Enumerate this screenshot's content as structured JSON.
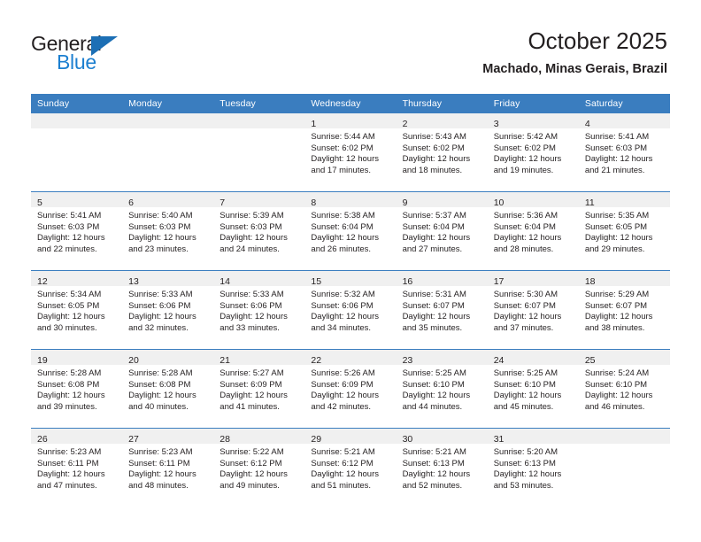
{
  "brand": {
    "name_top": "General",
    "name_bottom": "Blue",
    "accent_color": "#1c7fd0",
    "triangle_color": "#1c6fb5"
  },
  "header": {
    "title": "October 2025",
    "subtitle": "Machado, Minas Gerais, Brazil"
  },
  "calendar": {
    "header_bg": "#3a7dbf",
    "daynum_bg": "#f0f0f0",
    "weekday_headers": [
      "Sunday",
      "Monday",
      "Tuesday",
      "Wednesday",
      "Thursday",
      "Friday",
      "Saturday"
    ],
    "weeks": [
      [
        {
          "day": "",
          "lines": []
        },
        {
          "day": "",
          "lines": []
        },
        {
          "day": "",
          "lines": []
        },
        {
          "day": "1",
          "lines": [
            "Sunrise: 5:44 AM",
            "Sunset: 6:02 PM",
            "Daylight: 12 hours",
            "and 17 minutes."
          ]
        },
        {
          "day": "2",
          "lines": [
            "Sunrise: 5:43 AM",
            "Sunset: 6:02 PM",
            "Daylight: 12 hours",
            "and 18 minutes."
          ]
        },
        {
          "day": "3",
          "lines": [
            "Sunrise: 5:42 AM",
            "Sunset: 6:02 PM",
            "Daylight: 12 hours",
            "and 19 minutes."
          ]
        },
        {
          "day": "4",
          "lines": [
            "Sunrise: 5:41 AM",
            "Sunset: 6:03 PM",
            "Daylight: 12 hours",
            "and 21 minutes."
          ]
        }
      ],
      [
        {
          "day": "5",
          "lines": [
            "Sunrise: 5:41 AM",
            "Sunset: 6:03 PM",
            "Daylight: 12 hours",
            "and 22 minutes."
          ]
        },
        {
          "day": "6",
          "lines": [
            "Sunrise: 5:40 AM",
            "Sunset: 6:03 PM",
            "Daylight: 12 hours",
            "and 23 minutes."
          ]
        },
        {
          "day": "7",
          "lines": [
            "Sunrise: 5:39 AM",
            "Sunset: 6:03 PM",
            "Daylight: 12 hours",
            "and 24 minutes."
          ]
        },
        {
          "day": "8",
          "lines": [
            "Sunrise: 5:38 AM",
            "Sunset: 6:04 PM",
            "Daylight: 12 hours",
            "and 26 minutes."
          ]
        },
        {
          "day": "9",
          "lines": [
            "Sunrise: 5:37 AM",
            "Sunset: 6:04 PM",
            "Daylight: 12 hours",
            "and 27 minutes."
          ]
        },
        {
          "day": "10",
          "lines": [
            "Sunrise: 5:36 AM",
            "Sunset: 6:04 PM",
            "Daylight: 12 hours",
            "and 28 minutes."
          ]
        },
        {
          "day": "11",
          "lines": [
            "Sunrise: 5:35 AM",
            "Sunset: 6:05 PM",
            "Daylight: 12 hours",
            "and 29 minutes."
          ]
        }
      ],
      [
        {
          "day": "12",
          "lines": [
            "Sunrise: 5:34 AM",
            "Sunset: 6:05 PM",
            "Daylight: 12 hours",
            "and 30 minutes."
          ]
        },
        {
          "day": "13",
          "lines": [
            "Sunrise: 5:33 AM",
            "Sunset: 6:06 PM",
            "Daylight: 12 hours",
            "and 32 minutes."
          ]
        },
        {
          "day": "14",
          "lines": [
            "Sunrise: 5:33 AM",
            "Sunset: 6:06 PM",
            "Daylight: 12 hours",
            "and 33 minutes."
          ]
        },
        {
          "day": "15",
          "lines": [
            "Sunrise: 5:32 AM",
            "Sunset: 6:06 PM",
            "Daylight: 12 hours",
            "and 34 minutes."
          ]
        },
        {
          "day": "16",
          "lines": [
            "Sunrise: 5:31 AM",
            "Sunset: 6:07 PM",
            "Daylight: 12 hours",
            "and 35 minutes."
          ]
        },
        {
          "day": "17",
          "lines": [
            "Sunrise: 5:30 AM",
            "Sunset: 6:07 PM",
            "Daylight: 12 hours",
            "and 37 minutes."
          ]
        },
        {
          "day": "18",
          "lines": [
            "Sunrise: 5:29 AM",
            "Sunset: 6:07 PM",
            "Daylight: 12 hours",
            "and 38 minutes."
          ]
        }
      ],
      [
        {
          "day": "19",
          "lines": [
            "Sunrise: 5:28 AM",
            "Sunset: 6:08 PM",
            "Daylight: 12 hours",
            "and 39 minutes."
          ]
        },
        {
          "day": "20",
          "lines": [
            "Sunrise: 5:28 AM",
            "Sunset: 6:08 PM",
            "Daylight: 12 hours",
            "and 40 minutes."
          ]
        },
        {
          "day": "21",
          "lines": [
            "Sunrise: 5:27 AM",
            "Sunset: 6:09 PM",
            "Daylight: 12 hours",
            "and 41 minutes."
          ]
        },
        {
          "day": "22",
          "lines": [
            "Sunrise: 5:26 AM",
            "Sunset: 6:09 PM",
            "Daylight: 12 hours",
            "and 42 minutes."
          ]
        },
        {
          "day": "23",
          "lines": [
            "Sunrise: 5:25 AM",
            "Sunset: 6:10 PM",
            "Daylight: 12 hours",
            "and 44 minutes."
          ]
        },
        {
          "day": "24",
          "lines": [
            "Sunrise: 5:25 AM",
            "Sunset: 6:10 PM",
            "Daylight: 12 hours",
            "and 45 minutes."
          ]
        },
        {
          "day": "25",
          "lines": [
            "Sunrise: 5:24 AM",
            "Sunset: 6:10 PM",
            "Daylight: 12 hours",
            "and 46 minutes."
          ]
        }
      ],
      [
        {
          "day": "26",
          "lines": [
            "Sunrise: 5:23 AM",
            "Sunset: 6:11 PM",
            "Daylight: 12 hours",
            "and 47 minutes."
          ]
        },
        {
          "day": "27",
          "lines": [
            "Sunrise: 5:23 AM",
            "Sunset: 6:11 PM",
            "Daylight: 12 hours",
            "and 48 minutes."
          ]
        },
        {
          "day": "28",
          "lines": [
            "Sunrise: 5:22 AM",
            "Sunset: 6:12 PM",
            "Daylight: 12 hours",
            "and 49 minutes."
          ]
        },
        {
          "day": "29",
          "lines": [
            "Sunrise: 5:21 AM",
            "Sunset: 6:12 PM",
            "Daylight: 12 hours",
            "and 51 minutes."
          ]
        },
        {
          "day": "30",
          "lines": [
            "Sunrise: 5:21 AM",
            "Sunset: 6:13 PM",
            "Daylight: 12 hours",
            "and 52 minutes."
          ]
        },
        {
          "day": "31",
          "lines": [
            "Sunrise: 5:20 AM",
            "Sunset: 6:13 PM",
            "Daylight: 12 hours",
            "and 53 minutes."
          ]
        },
        {
          "day": "",
          "lines": []
        }
      ]
    ]
  }
}
